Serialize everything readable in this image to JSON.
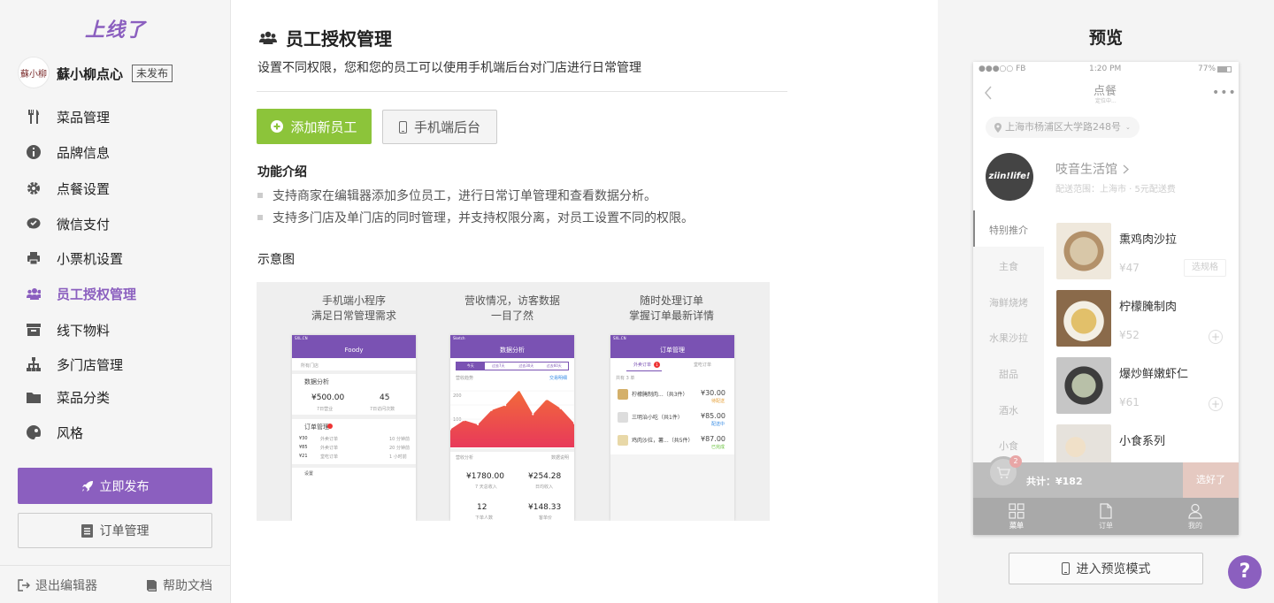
{
  "sidebar": {
    "logo": "上线了",
    "avatar_text": "蘇小柳",
    "store_name": "蘇小柳点心",
    "store_status": "未发布",
    "items": [
      {
        "label": "菜品管理",
        "icon": "fork-knife-icon"
      },
      {
        "label": "品牌信息",
        "icon": "info-icon"
      },
      {
        "label": "点餐设置",
        "icon": "gear-icon"
      },
      {
        "label": "微信支付",
        "icon": "wechat-icon"
      },
      {
        "label": "小票机设置",
        "icon": "printer-icon"
      },
      {
        "label": "员工授权管理",
        "icon": "users-icon",
        "active": true
      },
      {
        "label": "线下物料",
        "icon": "archive-icon"
      },
      {
        "label": "多门店管理",
        "icon": "sitemap-icon"
      },
      {
        "label": "菜品分类",
        "icon": "folder-icon"
      },
      {
        "label": "风格",
        "icon": "palette-icon"
      }
    ],
    "publish_label": "立即发布",
    "orders_label": "订单管理",
    "exit_label": "退出编辑器",
    "help_label": "帮助文档"
  },
  "main": {
    "title": "员工授权管理",
    "description": "设置不同权限，您和您的员工可以使用手机端后台对门店进行日常管理",
    "add_button": "添加新员工",
    "mobile_button": "手机端后台",
    "features_title": "功能介绍",
    "features": [
      "支持商家在编辑器添加多位员工，进行日常订单管理和查看数据分析。",
      "支持多门店及单门店的同时管理，并支持权限分离，对员工设置不同的权限。"
    ],
    "diagram_title": "示意图",
    "diagram": {
      "captions": [
        [
          "手机端小程序",
          "满足日常管理需求"
        ],
        [
          "营收情况，访客数据",
          "一目了然"
        ],
        [
          "随时处理订单",
          "掌握订单最新详情"
        ]
      ],
      "phone1": {
        "status": "SXL.CN",
        "header": "Foody",
        "store_select": "所有门店",
        "data_label": "数据分析",
        "revenue": "¥500.00",
        "revenue_label": "7日营业",
        "visits": "45",
        "visits_label": "7日访问次数",
        "orders_label": "订单管理",
        "order_rows": [
          [
            "¥30",
            "外卖订单",
            "10 分钟前"
          ],
          [
            "¥85",
            "外卖订单",
            "20 分钟前"
          ],
          [
            "¥21",
            "堂吃订单",
            "1 小时前"
          ]
        ],
        "settings_label": "设置"
      },
      "phone2": {
        "status": "Sketch",
        "header": "数据分析",
        "tabs": [
          "今天",
          "过去7天",
          "过去30天",
          "过去60天"
        ],
        "trend_label": "营收趋势",
        "trade_label": "交易明细",
        "y_ticks": [
          "200",
          "100"
        ],
        "analysis_label": "营收分析",
        "explain_label": "数据说明",
        "stats": [
          [
            "¥1780.00",
            "7 天总收入"
          ],
          [
            "¥254.28",
            "日均收入"
          ],
          [
            "12",
            "下单人数"
          ],
          [
            "¥148.33",
            "客单价"
          ]
        ],
        "chart_values": [
          30,
          45,
          38,
          62,
          70,
          95,
          55,
          80,
          65,
          40
        ]
      },
      "phone3": {
        "status": "SXL.CN",
        "header": "订单管理",
        "tabs": [
          "外卖订单",
          "堂吃订单"
        ],
        "badge": "1",
        "count_label": "共有 3 单",
        "orders": [
          [
            "柠檬腌制肉...（共3件）",
            "¥30.00",
            "待配送"
          ],
          [
            "三明治小吃（共1件）",
            "¥85.00",
            "配送中"
          ],
          [
            "鸡肉沙拉，薯...（共5件）",
            "¥87.00",
            "已完成"
          ]
        ]
      }
    }
  },
  "preview": {
    "title": "预览",
    "phone": {
      "carrier": "●●●○○ FB",
      "time": "1:20 PM",
      "battery": "77%",
      "header": "点餐",
      "subheader": "定位中...",
      "address": "上海市杨浦区大学路248号",
      "store_logo": "ziin!life!",
      "store_name": "吱音生活馆",
      "store_sub": "配送范围：上海市 · 5元配送费",
      "categories": [
        "特别推介",
        "主食",
        "海鲜烧烤",
        "水果沙拉",
        "甜品",
        "酒水",
        "小食"
      ],
      "dishes": [
        {
          "name": "熏鸡肉沙拉",
          "price": "¥47",
          "action": "选规格"
        },
        {
          "name": "柠檬腌制肉",
          "price": "¥52",
          "action": "+"
        },
        {
          "name": "爆炒鲜嫩虾仁",
          "price": "¥61",
          "action": "+"
        },
        {
          "name": "小食系列",
          "price": "",
          "action": ""
        }
      ],
      "cart_count": "2",
      "total": "共计：¥182",
      "checkout": "选好了",
      "tabs": [
        "菜单",
        "订单",
        "我的"
      ]
    },
    "mode_button": "进入预览模式",
    "help": "?"
  }
}
